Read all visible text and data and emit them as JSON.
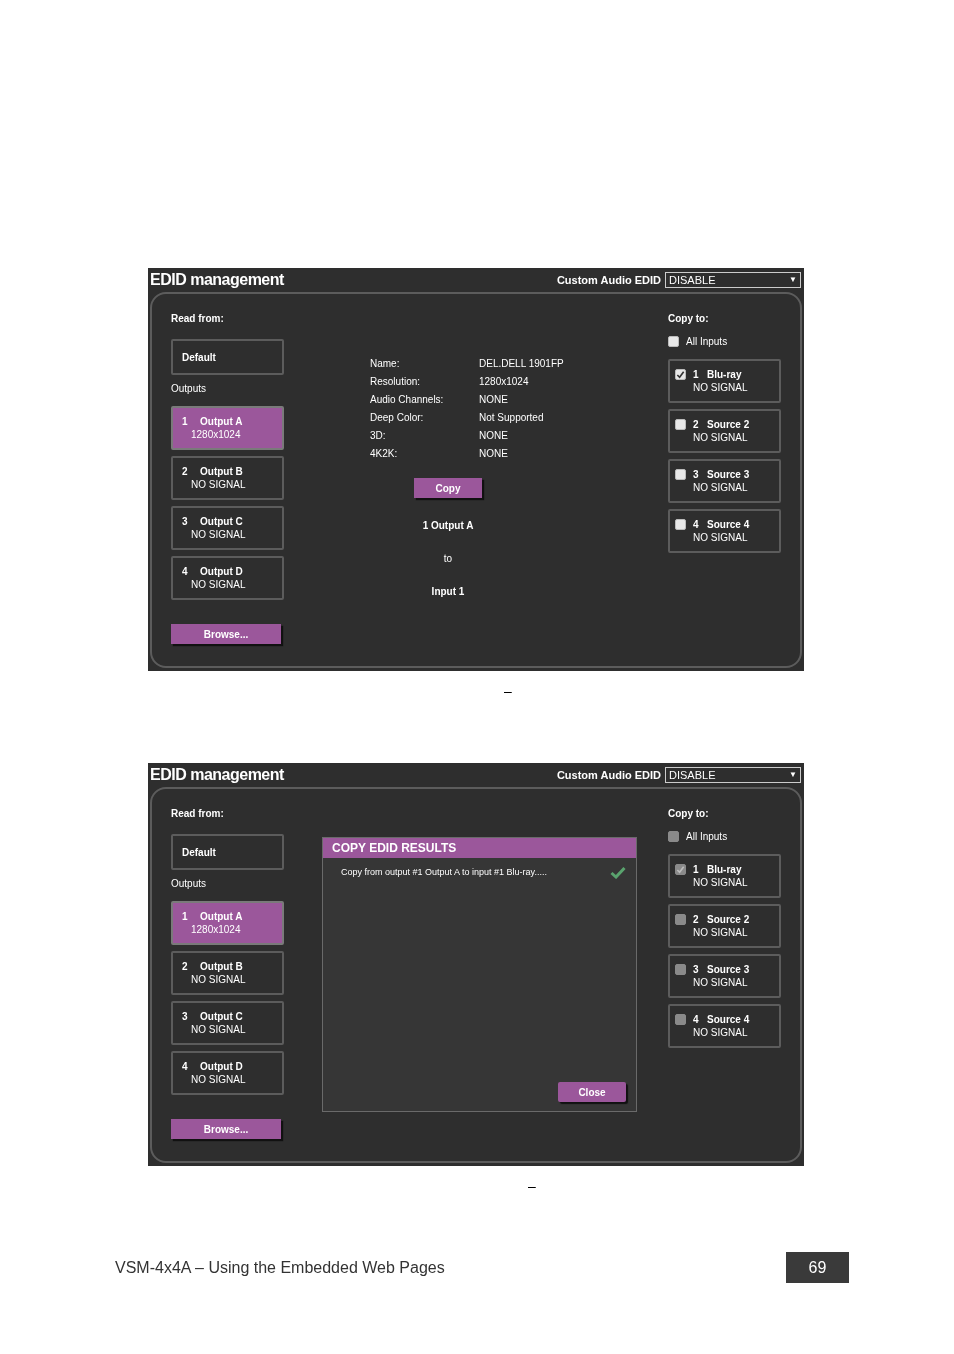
{
  "screenshots": [
    {
      "title": "EDID management",
      "audio_edid": {
        "label": "Custom Audio EDID",
        "value": "DISABLE",
        "arrow": "▼"
      },
      "read_from": "Read from:",
      "default_button": "Default",
      "outputs_label": "Outputs",
      "outputs": [
        {
          "number": "1",
          "name": "Output A",
          "status": "1280x1024",
          "selected": true
        },
        {
          "number": "2",
          "name": "Output B",
          "status": "NO SIGNAL",
          "selected": false
        },
        {
          "number": "3",
          "name": "Output C",
          "status": "NO SIGNAL",
          "selected": false
        },
        {
          "number": "4",
          "name": "Output D",
          "status": "NO SIGNAL",
          "selected": false
        }
      ],
      "browse": "Browse...",
      "center": {
        "kind": "info",
        "fields": [
          {
            "label": "Name:",
            "value": "DEL.DELL 1901FP"
          },
          {
            "label": "Resolution:",
            "value": "1280x1024"
          },
          {
            "label": "Audio Channels:",
            "value": "NONE"
          },
          {
            "label": "Deep Color:",
            "value": "Not Supported"
          },
          {
            "label": "3D:",
            "value": "NONE"
          },
          {
            "label": "4K2K:",
            "value": "NONE"
          }
        ],
        "copy_button": "Copy",
        "source": "1 Output A",
        "to": "to",
        "target": "Input 1"
      },
      "copy_to": "Copy to:",
      "all_inputs": {
        "label": "All Inputs",
        "checked": false,
        "disabled": false
      },
      "inputs": [
        {
          "number": "1",
          "name": "Blu-ray",
          "status": "NO SIGNAL",
          "checked": true,
          "disabled": false
        },
        {
          "number": "2",
          "name": "Source 2",
          "status": "NO SIGNAL",
          "checked": false,
          "disabled": false
        },
        {
          "number": "3",
          "name": "Source 3",
          "status": "NO SIGNAL",
          "checked": false,
          "disabled": false
        },
        {
          "number": "4",
          "name": "Source 4",
          "status": "NO SIGNAL",
          "checked": false,
          "disabled": false
        }
      ],
      "caption": "–"
    },
    {
      "title": "EDID management",
      "audio_edid": {
        "label": "Custom Audio EDID",
        "value": "DISABLE",
        "arrow": "▼"
      },
      "read_from": "Read from:",
      "default_button": "Default",
      "outputs_label": "Outputs",
      "outputs": [
        {
          "number": "1",
          "name": "Output A",
          "status": "1280x1024",
          "selected": true
        },
        {
          "number": "2",
          "name": "Output B",
          "status": "NO SIGNAL",
          "selected": false
        },
        {
          "number": "3",
          "name": "Output C",
          "status": "NO SIGNAL",
          "selected": false
        },
        {
          "number": "4",
          "name": "Output D",
          "status": "NO SIGNAL",
          "selected": false
        }
      ],
      "browse": "Browse...",
      "center": {
        "kind": "dialog",
        "title": "COPY EDID RESULTS",
        "message": "Copy from output #1 Output A to input #1 Blu-ray.....",
        "close": "Close"
      },
      "copy_to": "Copy to:",
      "all_inputs": {
        "label": "All Inputs",
        "checked": false,
        "disabled": true
      },
      "inputs": [
        {
          "number": "1",
          "name": "Blu-ray",
          "status": "NO SIGNAL",
          "checked": true,
          "disabled": true
        },
        {
          "number": "2",
          "name": "Source 2",
          "status": "NO SIGNAL",
          "checked": false,
          "disabled": true
        },
        {
          "number": "3",
          "name": "Source 3",
          "status": "NO SIGNAL",
          "checked": false,
          "disabled": true
        },
        {
          "number": "4",
          "name": "Source 4",
          "status": "NO SIGNAL",
          "checked": false,
          "disabled": true
        }
      ],
      "caption": "–"
    }
  ],
  "footer": {
    "text": "VSM-4x4A – Using the Embedded Web Pages",
    "page": "69"
  }
}
